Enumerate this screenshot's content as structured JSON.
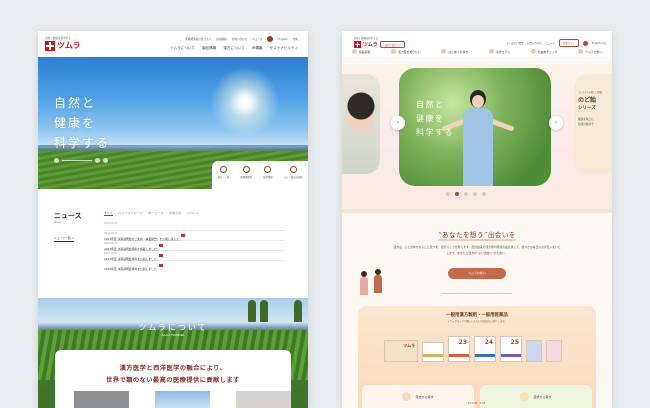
{
  "left": {
    "logo_tagline": "自然と健康を科学する",
    "logo_name": "ツムラ",
    "utility_links": [
      "医療関係者の皆さまへ",
      "採用情報",
      "お問い合わせ",
      "ニュース",
      "English",
      "中文"
    ],
    "nav": [
      "ツムラについて",
      "製品情報",
      "漢方について",
      "IR情報",
      "サステナビリティ"
    ],
    "hero_copy": [
      "自然と",
      "健康を",
      "科学する"
    ],
    "quick_links": [
      "漢方・一般",
      "医療関係者",
      "採用情報",
      "ツムラ漢方記念館"
    ],
    "news": {
      "title": "ニュース",
      "subtitle": "News",
      "more": "ニュース一覧 →",
      "tabs": [
        "すべて",
        "ニュースリリース",
        "IRニュース",
        "お知らせ",
        "イベント"
      ],
      "items": [
        {
          "date": "2024.03.15",
          "text": "2023年度 決算説明会のご案内（事業報告）を公開しました"
        },
        {
          "date": "2024.03.11",
          "text": "2023年度 決算説明会資料を掲載しました"
        },
        {
          "date": "2024.02.15",
          "text": "2023年度 決算説明会資料を公開しました"
        },
        {
          "date": "2024.02.11",
          "text": "2023年度 決算説明会資料を公開しました"
        }
      ]
    },
    "about": {
      "title": "ツムラについて",
      "subtitle": "About TSUMURA",
      "lead": [
        "漢方医学と西洋医学の融合により、",
        "世界で類のない最高の医療提供に貢献します"
      ]
    }
  },
  "right": {
    "logo_tagline": "自然と健康を科学する",
    "logo_name": "ツムラ",
    "logo_badge": "一般向け製品サイト",
    "utility_links": [
      "よくあるご質問",
      "お問い合わせ",
      "ニュース"
    ],
    "utility_button": "企業サイト",
    "utility_lang": "English  中文",
    "nav": [
      "製品情報",
      "漢方薬を知りたい",
      "はじめての漢方",
      "漢方コラム",
      "気血水チェック",
      "ツムラの想い"
    ],
    "hero_copy": [
      "自然と",
      "健康を",
      "科学する"
    ],
    "side_slide": {
      "label": "ツムラからの新しい提案",
      "title": "のど飴",
      "series": "シリーズ",
      "desc": [
        "健康を毎日に",
        "和漢の素材で"
      ]
    },
    "arrows": {
      "prev": "‹",
      "next": "›"
    },
    "concept_title": "“あなたを想う”出会いを",
    "concept_text": "漢方は、心と身体をまるごと見つめ、自分らしさを整えます。自然由来の漢方薬や関連商品を通して、健やかな毎日のお手伝いをいたします。あなたと漢方の”よい出会い”のために。",
    "concept_button": "ツムラの想い",
    "otc_title": "一般用漢方製剤・一般用医薬品",
    "otc_subtitle": "ドラッグストアで購入いただける製品をご紹介します。",
    "product_numbers": [
      "23",
      "24",
      "25"
    ],
    "product_label": "ツムラ",
    "search": [
      {
        "label": "漢方から探す"
      },
      {
        "label": "症状から探す"
      }
    ],
    "pickup": "PICK UP"
  },
  "colors": {
    "brand_red": "#c8161d",
    "accent_brown": "#9a3c2d",
    "terracotta": "#c6684a"
  }
}
